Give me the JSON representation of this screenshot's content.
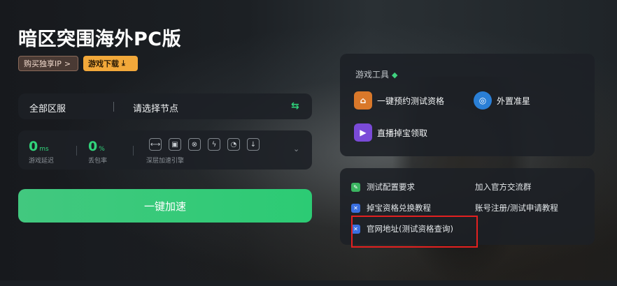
{
  "app": {
    "title": "暗区突围海外PC版"
  },
  "header": {
    "buy_ip_label": "购买独享IP",
    "buy_ip_arrow": ">",
    "download_label": "游戏下载",
    "download_icon": "⤓"
  },
  "region": {
    "server_label": "全部区服",
    "node_label": "请选择节点",
    "swap_icon": "⇆"
  },
  "stats": {
    "latency_value": "0",
    "latency_unit": "ms",
    "latency_label": "游戏延迟",
    "loss_value": "0",
    "loss_unit": "%",
    "loss_label": "丢包率",
    "engine_label": "深层加速引擎",
    "engine_icons": [
      "⟷",
      "▣",
      "⊗",
      "ϟ",
      "◔",
      "↓"
    ],
    "expand_icon": "⌄"
  },
  "boost": {
    "label": "一键加速"
  },
  "tools": {
    "heading": "游戏工具",
    "heading_icon": "◆",
    "items": [
      {
        "label": "一键预约测试资格",
        "icon": "⌂"
      },
      {
        "label": "外置准星",
        "icon": "◎"
      },
      {
        "label": "直播掉宝领取",
        "icon": "▶"
      }
    ]
  },
  "links": {
    "items": [
      {
        "label": "测试配置要求",
        "icon": "✎"
      },
      {
        "label": "加入官方交流群"
      },
      {
        "label": "掉宝资格兑换教程",
        "icon": "✕"
      },
      {
        "label": "账号注册/测试申请教程"
      },
      {
        "label": "官网地址(测试资格查询)",
        "icon": "✕"
      }
    ]
  },
  "colors": {
    "accent_green": "#2ccb74",
    "download_orange": "#f2a83a",
    "highlight_red": "#e32020"
  }
}
